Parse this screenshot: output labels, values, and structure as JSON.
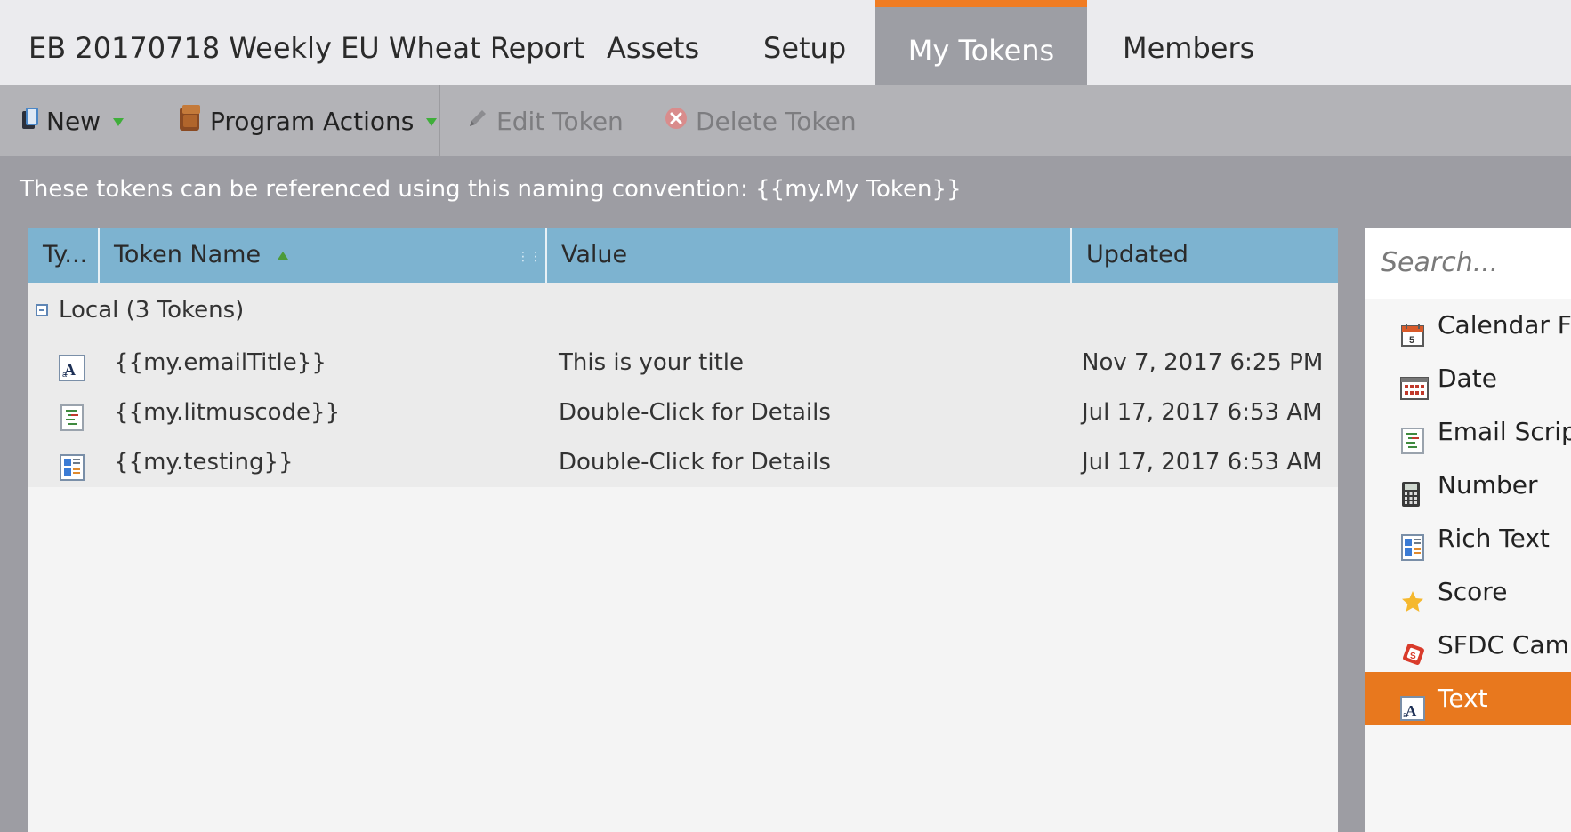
{
  "tabs": {
    "program": "EB 20170718 Weekly EU Wheat Report",
    "assets": "Assets",
    "setup": "Setup",
    "my_tokens": "My Tokens",
    "members": "Members"
  },
  "toolbar": {
    "new": "New",
    "program_actions": "Program Actions",
    "edit_token": "Edit Token",
    "delete_token": "Delete Token"
  },
  "info_text": "These tokens can be referenced using this naming convention: {{my.My Token}}",
  "grid": {
    "headers": {
      "type": "Ty...",
      "name": "Token Name",
      "value": "Value",
      "updated": "Updated"
    },
    "group_label": "Local (3 Tokens)",
    "rows": [
      {
        "icon": "text-token-icon",
        "name": "{{my.emailTitle}}",
        "value": "This is your title",
        "updated": "Nov 7, 2017 6:25 PM"
      },
      {
        "icon": "email-script-token-icon",
        "name": "{{my.litmuscode}}",
        "value": "Double-Click for Details",
        "updated": "Jul 17, 2017 6:53 AM"
      },
      {
        "icon": "rich-text-token-icon",
        "name": "{{my.testing}}",
        "value": "Double-Click for Details",
        "updated": "Jul 17, 2017 6:53 AM"
      }
    ]
  },
  "side_panel": {
    "search_placeholder": "Search...",
    "items": [
      {
        "label": "Calendar Fil",
        "icon": "calendar-icon"
      },
      {
        "label": "Date",
        "icon": "date-icon"
      },
      {
        "label": "Email Script",
        "icon": "email-script-icon"
      },
      {
        "label": "Number",
        "icon": "number-icon"
      },
      {
        "label": "Rich Text",
        "icon": "rich-text-icon"
      },
      {
        "label": "Score",
        "icon": "star-icon"
      },
      {
        "label": "SFDC Camp",
        "icon": "sfdc-campaign-icon"
      },
      {
        "label": "Text",
        "icon": "text-icon",
        "selected": true
      }
    ]
  },
  "colors": {
    "accent": "#e8781e",
    "header_blue": "#7db3d0"
  }
}
